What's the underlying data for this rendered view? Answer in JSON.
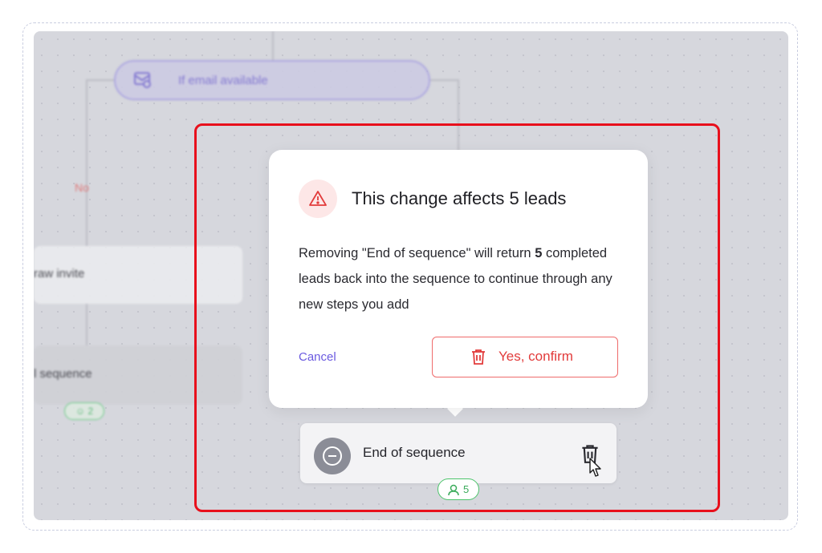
{
  "background": {
    "condition_node": {
      "label": "If email available",
      "icon": "mail-check-icon"
    },
    "branch_no_label": "No",
    "card_1_label": "raw invite",
    "card_2_label": "l sequence",
    "card_2_badge": "2"
  },
  "modal": {
    "icon": "warning-triangle-icon",
    "title": "This change affects 5 leads",
    "body_part1": "Removing \"End of sequence\" will return ",
    "body_bold": "5",
    "body_part2": " completed leads back into the sequence to continue through any new steps you add",
    "cancel_label": "Cancel",
    "confirm_label": "Yes, confirm",
    "confirm_icon": "trash-icon"
  },
  "end_of_sequence": {
    "label": "End of sequence",
    "icon": "minus-circle-icon",
    "delete_icon": "trash-icon",
    "leads_count": "5",
    "leads_icon": "user-icon"
  },
  "colors": {
    "highlight": "#e8101c",
    "danger": "#e23b3b",
    "accent": "#6b5ae0",
    "success": "#3bab5b"
  }
}
